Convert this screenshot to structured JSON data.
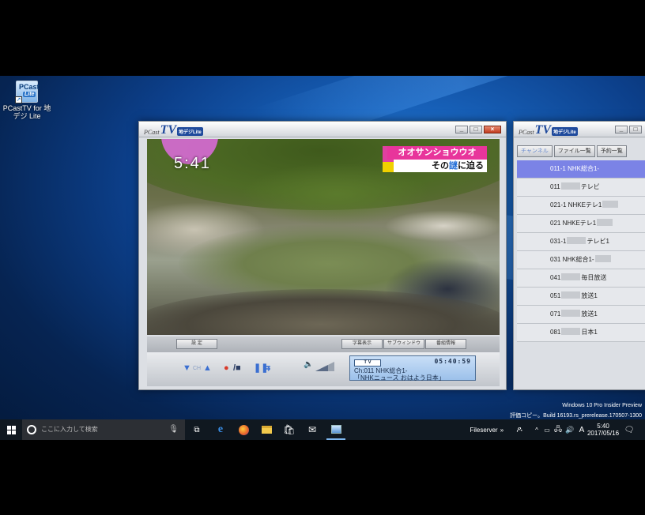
{
  "desktop": {
    "icon_label": "PCastTV for 地デジ Lite",
    "watermark_line1": "Windows 10 Pro Insider Preview",
    "watermark_line2": "評価コピー。Build 16193.rs_prerelease.170507-1300"
  },
  "tv_window": {
    "logo_prefix": "PCast",
    "logo_main": "TV",
    "logo_badge": "地デジLite",
    "overlay_clock": "5:41",
    "overlay_caption_line1": "オオサンショウウオ",
    "overlay_caption_line2_pre": "その",
    "overlay_caption_line2_hl": "謎",
    "overlay_caption_line2_post": "に迫る",
    "buttons": {
      "settings": "設 定",
      "subtitles": "字幕表示",
      "subwindow": "サブウィンドウ",
      "program_info": "番組情報"
    },
    "ch_label": "CH",
    "lcd": {
      "tag": "T V",
      "time": "05:40:59",
      "line1": "Ch:011 NHK総合1-",
      "line2": "「NHKニュース おはよう日本」"
    }
  },
  "channel_window": {
    "logo_prefix": "PCast",
    "logo_main": "TV",
    "logo_badge": "地デジLite",
    "tabs": [
      "チャンネル",
      "ファイル一覧",
      "予約一覧"
    ],
    "channels": [
      {
        "a": "011-1 NHK総合1-",
        "b": "",
        "selected": true
      },
      {
        "a": "011",
        "b": "テレビ",
        "selected": false
      },
      {
        "a": "021-1 NHKEテレ1",
        "b": "",
        "selected": false
      },
      {
        "a": "021 NHKEテレ1",
        "b": "",
        "selected": false
      },
      {
        "a": "031-1",
        "b": "テレビ1",
        "selected": false
      },
      {
        "a": "031 NHK総合1-",
        "b": "",
        "selected": false
      },
      {
        "a": "041",
        "b": "毎日放送",
        "selected": false
      },
      {
        "a": "051",
        "b": "放送1",
        "selected": false
      },
      {
        "a": "071",
        "b": "放送1",
        "selected": false
      },
      {
        "a": "081",
        "b": "日本1",
        "selected": false
      }
    ]
  },
  "taskbar": {
    "search_placeholder": "ここに入力して検索",
    "fileserver_label": "Fileserver",
    "ime_label": "A",
    "clock_time": "5:40",
    "clock_date": "2017/05/16"
  },
  "colors": {
    "desktop_blue": "#1760b8",
    "selected_row": "#7b83e6",
    "caption_pink": "#e8359b",
    "lcd_blue": "#9cc1ea"
  }
}
